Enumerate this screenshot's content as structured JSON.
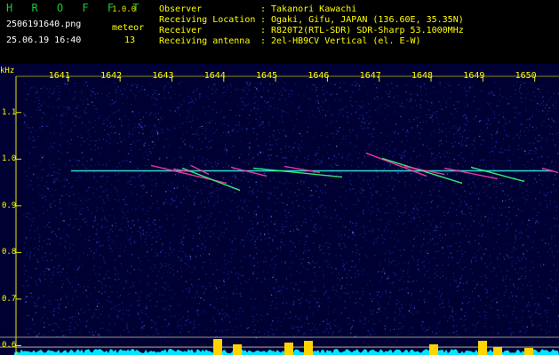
{
  "header": {
    "brand": "H R O F F T",
    "version": "1.0.0",
    "filename": "2506191640.png",
    "datetime": "25.06.19 16:40",
    "meteor_label": "meteor",
    "meteor_count": "13",
    "info": [
      {
        "label": "Observer",
        "value": "Takanori Kawachi"
      },
      {
        "label": "Receiving Location",
        "value": "Ogaki, Gifu, JAPAN (136.60E, 35.35N)"
      },
      {
        "label": "Receiver",
        "value": "R820T2(RTL-SDR) SDR-Sharp 53.1000MHz"
      },
      {
        "label": "Receiving antenna",
        "value": "2el-HB9CV Vertical (el. E-W)"
      }
    ]
  },
  "chart_data": {
    "type": "heatmap",
    "ylabel": "kHz",
    "x_ticks": [
      "1641",
      "1642",
      "1643",
      "1644",
      "1645",
      "1646",
      "1647",
      "1648",
      "1649",
      "1650"
    ],
    "y_ticks": [
      "1.1",
      "1.0",
      "0.9",
      "0.8",
      "0.7",
      "0.6"
    ],
    "xlim": [
      1640.3,
      1650.4
    ],
    "ylim": [
      0.58,
      1.17
    ],
    "carrier_khz": 0.975,
    "meteor_count": 13,
    "colors": {
      "background": "#000033",
      "noise": "#1a2a9a",
      "carrier": "#2fd8d0",
      "trace": "#ff3aa8",
      "trace_alt": "#39ff7a",
      "level": "#00e5ff",
      "peak": "#ffd400"
    }
  }
}
